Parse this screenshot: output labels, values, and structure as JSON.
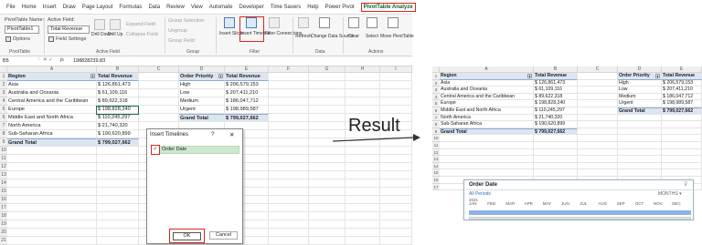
{
  "menu": [
    "File",
    "Home",
    "Insert",
    "Draw",
    "Page Layout",
    "Formulas",
    "Data",
    "Review",
    "View",
    "Automate",
    "Developer",
    "Time Savers",
    "Help",
    "Power Pivot",
    "PivotTable Analyze"
  ],
  "ribbon": {
    "pivot_name_label": "PivotTable Name:",
    "pivot_name_value": "PivotTable1",
    "options_label": "Options",
    "active_field_label": "Active Field:",
    "active_field_value": "Total Revenue",
    "field_settings_label": "Field Settings",
    "drill_down": "Drill Down",
    "drill_up": "Drill Up",
    "expand_field": "Expand Field",
    "collapse_field": "Collapse Field",
    "group_selection": "Group Selection",
    "ungroup": "Ungroup",
    "group_field": "Group Field",
    "insert_slicer": "Insert Slicer",
    "insert_timeline": "Insert Timeline",
    "filter_connections": "Filter Connections",
    "refresh": "Refresh",
    "change_data_source": "Change Data Source",
    "clear": "Clear",
    "select": "Select",
    "move_pivottable": "Move PivotTable",
    "groups": {
      "pivottable": "PivotTable",
      "active_field": "Active Field",
      "group": "Group",
      "filter": "Filter",
      "data": "Data",
      "actions": "Actions"
    }
  },
  "formula_bar": {
    "name_box": "B5",
    "value": "198828239.83",
    "fx": "fx"
  },
  "columns": [
    "A",
    "B",
    "C",
    "D",
    "E",
    "F",
    "G",
    "H",
    "I"
  ],
  "result_columns": [
    "A",
    "B",
    "C",
    "D",
    "E"
  ],
  "rows": [
    "1",
    "2",
    "3",
    "4",
    "5",
    "6",
    "7",
    "8",
    "9",
    "10",
    "11",
    "12",
    "13",
    "14",
    "15",
    "16",
    "17",
    "18",
    "19",
    "20",
    "21"
  ],
  "result_rows": [
    "1",
    "2",
    "3",
    "4",
    "5",
    "6",
    "7",
    "8",
    "9",
    "10",
    "11",
    "12",
    "13",
    "14",
    "15",
    "16",
    "17"
  ],
  "table_left": {
    "header": [
      "Region",
      "Total Revenue"
    ],
    "rows": [
      [
        "Asia",
        "$  126,861,473"
      ],
      [
        "Australia and Oceania",
        "$    61,109,116"
      ],
      [
        "Central America and the Caribbean",
        "$    89,622,318"
      ],
      [
        "Europe",
        "$  198,828,240"
      ],
      [
        "Middle East and North Africa",
        "$  110,245,297"
      ],
      [
        "North America",
        "$    21,740,320"
      ],
      [
        "Sub-Saharan Africa",
        "$  190,620,899"
      ]
    ],
    "total": [
      "Grand Total",
      "$  799,027,662"
    ]
  },
  "table_right": {
    "header": [
      "Order Priority",
      "Total Revenue"
    ],
    "rows": [
      [
        "High",
        "$  206,579,153"
      ],
      [
        "Low",
        "$  207,411,210"
      ],
      [
        "Medium",
        "$  186,047,712"
      ],
      [
        "Urgent",
        "$  198,989,587"
      ]
    ],
    "total": [
      "Grand Total",
      "$  799,027,662"
    ]
  },
  "dialog": {
    "title": "Insert Timelines",
    "help": "?",
    "close": "✕",
    "item": "Order Date",
    "ok": "OK",
    "cancel": "Cancel"
  },
  "result_label": "Result",
  "timeline": {
    "title": "Order Date",
    "all_periods": "All Periods",
    "level": "MONTHS",
    "year": "2021",
    "months": [
      "JAN",
      "FEB",
      "MAR",
      "APR",
      "MAY",
      "JUN",
      "JUL",
      "AUG",
      "SEP",
      "OCT",
      "NOV",
      "DEC"
    ]
  },
  "colors": {
    "accent": "#d9261c",
    "header": "#dce6f1",
    "selection": "#cde8cf",
    "timeline_bar": "#8db3e2"
  }
}
